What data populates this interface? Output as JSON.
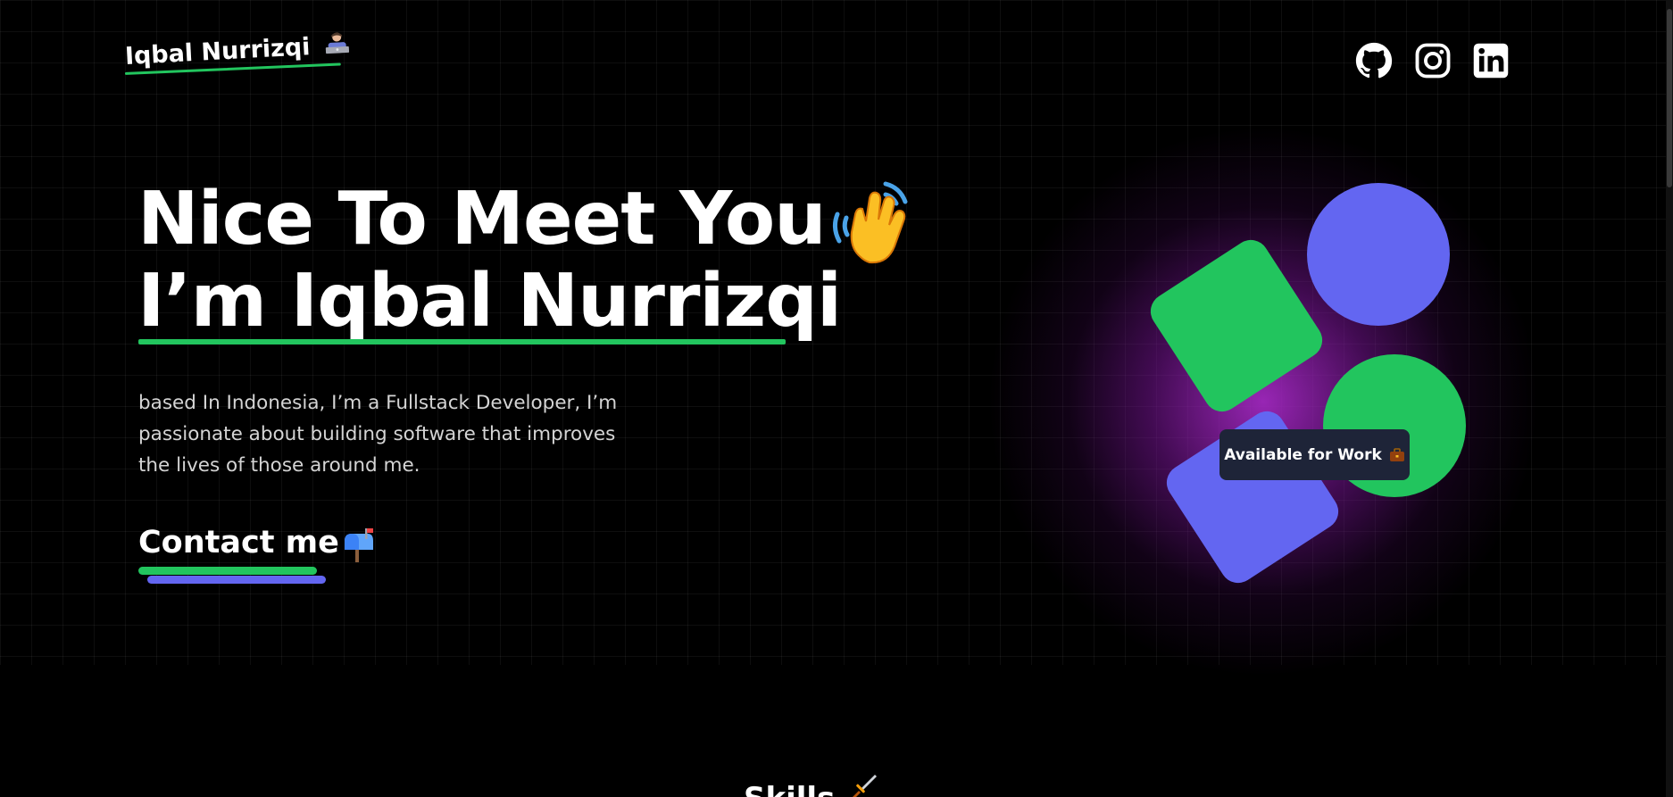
{
  "header": {
    "logo_text": "Iqbal Nurrizqi",
    "logo_icon": "technologist-emoji-icon",
    "social": [
      {
        "name": "github",
        "icon": "github-icon"
      },
      {
        "name": "instagram",
        "icon": "instagram-icon"
      },
      {
        "name": "linkedin",
        "icon": "linkedin-icon"
      }
    ]
  },
  "hero": {
    "line1": "Nice To Meet You",
    "line2": "I’m Iqbal Nurrizqi",
    "wave_icon": "waving-hand-icon",
    "description": "based In Indonesia, I’m a Fullstack Developer, I’m passionate about building software that improves the lives of those around me.",
    "contact_label": "Contact me",
    "contact_icon": "mailbox-icon",
    "badge_label": "Available for Work",
    "badge_icon": "briefcase-icon"
  },
  "skills": {
    "title": "Skills",
    "icon": "dagger-icon"
  },
  "colors": {
    "background": "#000000",
    "green": "#22c55e",
    "indigo": "#6366f1",
    "glow": "#a21caf",
    "badge_bg": "#1e2438"
  }
}
